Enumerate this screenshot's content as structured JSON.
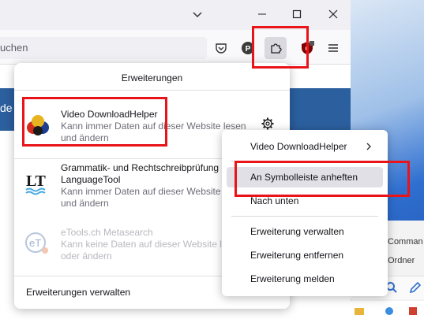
{
  "address_bar": {
    "partial_text": "uchen"
  },
  "page_partial_text": "de",
  "extensions_panel": {
    "title": "Erweiterungen",
    "extensions": [
      {
        "name": "Video DownloadHelper",
        "description_line1": "Kann immer Daten auf dieser Website lesen",
        "description_line2": "und ändern",
        "icon": "video-downloadhelper-icon",
        "enabled": true
      },
      {
        "name": "Grammatik- und Rechtschreibprüfung -",
        "name_line2": "LanguageTool",
        "description_line1": "Kann immer Daten auf dieser Website le",
        "description_line2": "und ändern",
        "icon": "languagetool-icon",
        "enabled": true
      },
      {
        "name": "eTools.ch Metasearch",
        "description_line1": "Kann keine Daten auf dieser Website le",
        "description_line2": "oder ändern",
        "icon": "etools-icon",
        "enabled": false
      }
    ],
    "footer_label": "Erweiterungen verwalten"
  },
  "context_menu": {
    "items": [
      {
        "label": "Video DownloadHelper",
        "submenu": true
      },
      {
        "label": "An Symbolleiste anheften",
        "highlighted": true
      },
      {
        "label": "Nach unten"
      },
      {
        "label": "Erweiterung verwalten"
      },
      {
        "label": "Erweiterung entfernen"
      },
      {
        "label": "Erweiterung melden"
      }
    ]
  },
  "background": {
    "line1": "Comman",
    "line2": "Ordner"
  },
  "colors": {
    "highlight_red": "#e8141a",
    "page_accent": "#2b5f9e"
  }
}
